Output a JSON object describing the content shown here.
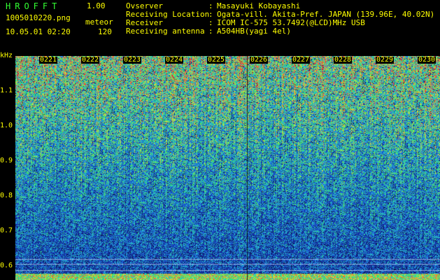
{
  "header": {
    "app_title": "HROFFT",
    "version": "1.00",
    "filename": "1005010220.png",
    "mode_label": "meteor",
    "datetime": "10.05.01 02:20",
    "count": "120"
  },
  "station_info": [
    {
      "label": "Ovserver",
      "value": "Masayuki Kobayashi"
    },
    {
      "label": "Receiving Location",
      "value": "Ogata-vill. Akita-Pref. JAPAN (139.96E, 40.02N)"
    },
    {
      "label": "Receiver",
      "value": "ICOM IC-575 53.7492(@LCD)MHz USB"
    },
    {
      "label": "Receiving antenna",
      "value": "A504HB(yagi 4el)"
    }
  ],
  "separator": ":",
  "freq_axis": {
    "unit": "kHz",
    "ticks": [
      "1.1",
      "1.0",
      "0.9",
      "0.8",
      "0.7",
      "0.6"
    ]
  },
  "time_axis": {
    "labels": [
      "0221",
      "0222",
      "0223",
      "0224",
      "0225",
      "0226",
      "0227",
      "0228",
      "0229",
      "0230"
    ]
  },
  "colors": {
    "text": "#ffff00",
    "title": "#33ff33",
    "background": "#000000",
    "spectrum_low": "#101c70",
    "spectrum_mid": "#1e6ee0",
    "spectrum_high": "#40e070",
    "spectrum_peak": "#ff3030"
  }
}
